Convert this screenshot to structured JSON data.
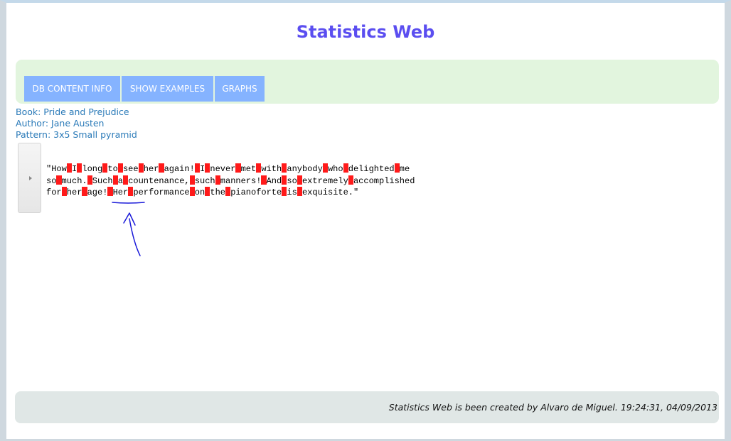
{
  "title": "Statistics Web",
  "menu": [
    {
      "label": "DB CONTENT INFO"
    },
    {
      "label": "SHOW EXAMPLES"
    },
    {
      "label": "GRAPHS"
    }
  ],
  "info": {
    "book": "Book: Pride and Prejudice",
    "author": "Author: Jane Austen",
    "pattern": "Pattern: 3x5 Small pyramid"
  },
  "excerpt": {
    "lines": [
      [
        "\"How",
        "I",
        "long",
        "to",
        "see",
        "her",
        "again!",
        "I",
        "never",
        "met",
        "with",
        "anybody",
        "who",
        "delighted",
        "me"
      ],
      [
        "so",
        "much.",
        "Such",
        "a",
        "countenance,",
        "such",
        "manners!",
        "And",
        "so",
        "extremely",
        "accomplished"
      ],
      [
        "for",
        "her",
        "age!",
        "Her",
        "performance",
        "on",
        "the",
        "pianoforte",
        "is",
        "exquisite.\""
      ]
    ],
    "gap_color": "#ff1a1a"
  },
  "footer": {
    "text": "Statistics Web is been created by Alvaro de Miguel. 19:24:31, 04/09/2013"
  },
  "colors": {
    "title": "#5b4ef0",
    "menu_button": "#85b3ff",
    "menu_panel": "#e2f5de",
    "info_text": "#2a7ab8",
    "footer_panel": "#e0e7e6",
    "annotation": "#1a1ad9"
  }
}
